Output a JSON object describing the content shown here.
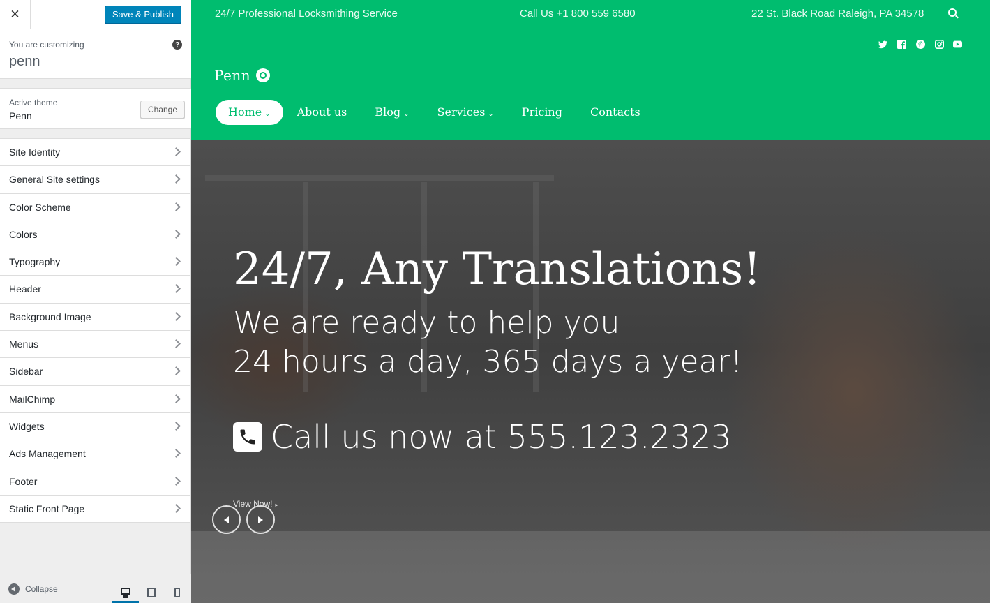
{
  "customizer": {
    "close_icon": "close-icon",
    "publish_label": "Save & Publish",
    "customizing_label": "You are customizing",
    "site_name": "penn",
    "help_icon": "help-icon",
    "active_theme_label": "Active theme",
    "theme_name": "Penn",
    "change_label": "Change",
    "sections": [
      {
        "label": "Site Identity"
      },
      {
        "label": "General Site settings"
      },
      {
        "label": "Color Scheme"
      },
      {
        "label": "Colors"
      },
      {
        "label": "Typography"
      },
      {
        "label": "Header"
      },
      {
        "label": "Background Image"
      },
      {
        "label": "Menus"
      },
      {
        "label": "Sidebar"
      },
      {
        "label": "MailChimp"
      },
      {
        "label": "Widgets"
      },
      {
        "label": "Ads Management"
      },
      {
        "label": "Footer"
      },
      {
        "label": "Static Front Page"
      }
    ],
    "collapse_label": "Collapse",
    "devices": [
      "desktop-icon",
      "tablet-icon",
      "mobile-icon"
    ],
    "active_device": "desktop-icon"
  },
  "site": {
    "topbar": {
      "service": "24/7 Professional Locksmithing Service",
      "phone": "Call Us +1 800 559 6580",
      "address": "22 St. Black Road Raleigh, PA 34578"
    },
    "social_icons": [
      "twitter-icon",
      "facebook-icon",
      "pinterest-icon",
      "instagram-icon",
      "youtube-icon"
    ],
    "logo_text": "Penn",
    "nav": [
      {
        "label": "Home",
        "has_dropdown": true,
        "active": true
      },
      {
        "label": "About us",
        "has_dropdown": false
      },
      {
        "label": "Blog",
        "has_dropdown": true
      },
      {
        "label": "Services",
        "has_dropdown": true
      },
      {
        "label": "Pricing",
        "has_dropdown": false
      },
      {
        "label": "Contacts",
        "has_dropdown": false
      }
    ],
    "hero": {
      "title": "24/7, Any Translations!",
      "subtitle_line1": "We are ready to help you",
      "subtitle_line2": "24 hours a day, 365 days a year!",
      "call_text": "Call us now at 555.123.2323",
      "view_now": "View Now!"
    }
  },
  "colors": {
    "brand_green": "#00bd6f",
    "publish_blue": "#0085ba"
  }
}
